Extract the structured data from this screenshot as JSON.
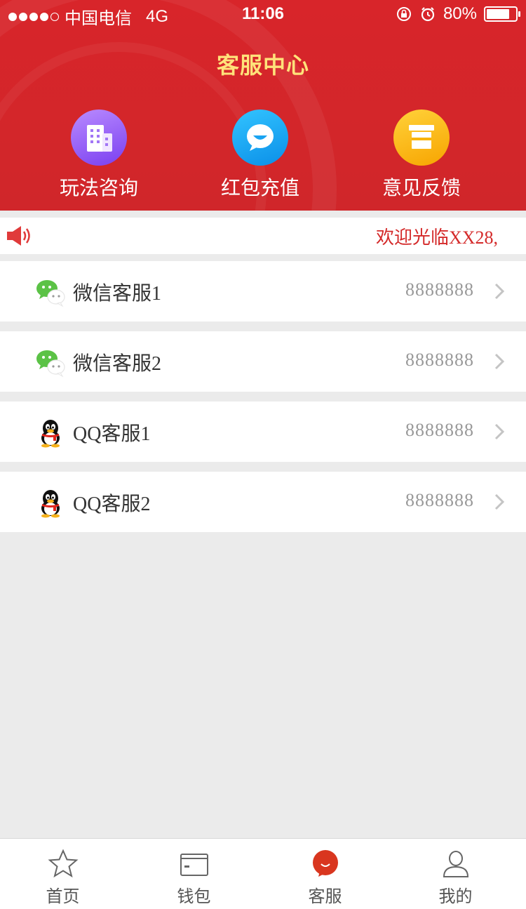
{
  "status_bar": {
    "carrier": "中国电信",
    "network": "4G",
    "time": "11:06",
    "battery": "80%"
  },
  "header": {
    "title": "客服中心"
  },
  "quick_actions": [
    {
      "label": "玩法咨询",
      "icon": "building-icon"
    },
    {
      "label": "红包充值",
      "icon": "chat-bubble-icon"
    },
    {
      "label": "意见反馈",
      "icon": "box-icon"
    }
  ],
  "notice": {
    "text": "欢迎光临XX28,"
  },
  "contacts": [
    {
      "name": "微信客服1",
      "value": "8888888",
      "icon": "wechat-icon"
    },
    {
      "name": "微信客服2",
      "value": "8888888",
      "icon": "wechat-icon"
    },
    {
      "name": "QQ客服1",
      "value": "8888888",
      "icon": "qq-penguin-icon"
    },
    {
      "name": "QQ客服2",
      "value": "8888888",
      "icon": "qq-penguin-icon"
    }
  ],
  "tabbar": {
    "items": [
      {
        "label": "首页",
        "icon": "star-icon"
      },
      {
        "label": "钱包",
        "icon": "wallet-icon"
      },
      {
        "label": "客服",
        "icon": "service-icon",
        "active": true
      },
      {
        "label": "我的",
        "icon": "user-icon"
      }
    ]
  },
  "colors": {
    "brand_red": "#d3262a",
    "title_yellow": "#ffe27a",
    "notice_red": "#d42a2a"
  }
}
